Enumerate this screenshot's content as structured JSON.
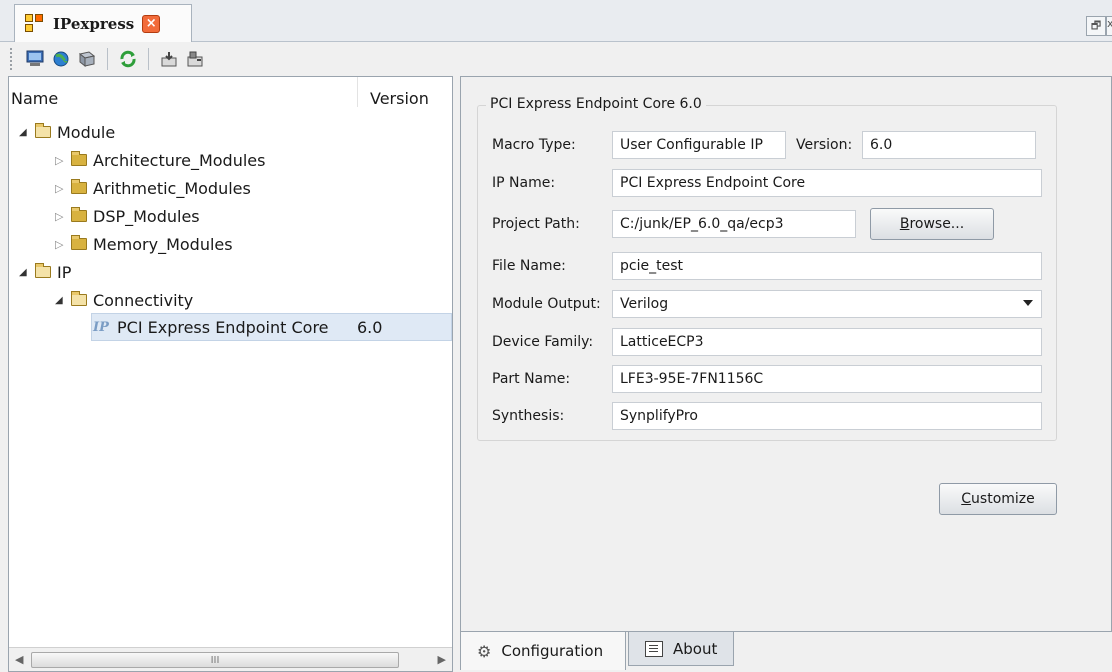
{
  "window": {
    "tab_title": "IPexpress",
    "close_tab_glyph": "×",
    "restore_glyph": "🗗",
    "close_glyph": "x"
  },
  "toolbar": {
    "icons": [
      "computer-icon",
      "globe-icon",
      "catalog-icon",
      "refresh-icon",
      "import-icon",
      "export-icon"
    ]
  },
  "tree": {
    "col_name": "Name",
    "col_version": "Version",
    "nodes": [
      {
        "label": "Module",
        "expanded": true,
        "depth": 0
      },
      {
        "label": "Architecture_Modules",
        "expanded": false,
        "depth": 1
      },
      {
        "label": "Arithmetic_Modules",
        "expanded": false,
        "depth": 1
      },
      {
        "label": "DSP_Modules",
        "expanded": false,
        "depth": 1
      },
      {
        "label": "Memory_Modules",
        "expanded": false,
        "depth": 1
      },
      {
        "label": "IP",
        "expanded": true,
        "depth": 0
      },
      {
        "label": "Connectivity",
        "expanded": true,
        "depth": 1
      },
      {
        "label": "PCI Express Endpoint Core",
        "version": "6.0",
        "depth": 2,
        "selected": true
      }
    ],
    "scroll_thumb_glyph": "III"
  },
  "config": {
    "group_title": "PCI Express Endpoint Core 6.0",
    "macro_type_label": "Macro Type:",
    "macro_type_value": "User Configurable IP",
    "version_label": "Version:",
    "version_value": "6.0",
    "ip_name_label": "IP Name:",
    "ip_name_value": "PCI Express Endpoint Core",
    "project_path_label": "Project Path:",
    "project_path_value": "C:/junk/EP_6.0_qa/ecp3",
    "browse_label_mnemonic": "B",
    "browse_label_rest": "rowse...",
    "file_name_label": "File Name:",
    "file_name_value": "pcie_test",
    "module_output_label": "Module Output:",
    "module_output_value": "Verilog",
    "device_family_label": "Device Family:",
    "device_family_value": "LatticeECP3",
    "part_name_label": "Part Name:",
    "part_name_value": "LFE3-95E-7FN1156C",
    "synthesis_label": "Synthesis:",
    "synthesis_value": "SynplifyPro",
    "customize_mnemonic": "C",
    "customize_rest": "ustomize"
  },
  "bottom_tabs": {
    "configuration": "Configuration",
    "about": "About"
  },
  "colors": {
    "selection": "#dfe9f5",
    "folder": "#e9c86a",
    "close_tab": "#f26b3a"
  }
}
